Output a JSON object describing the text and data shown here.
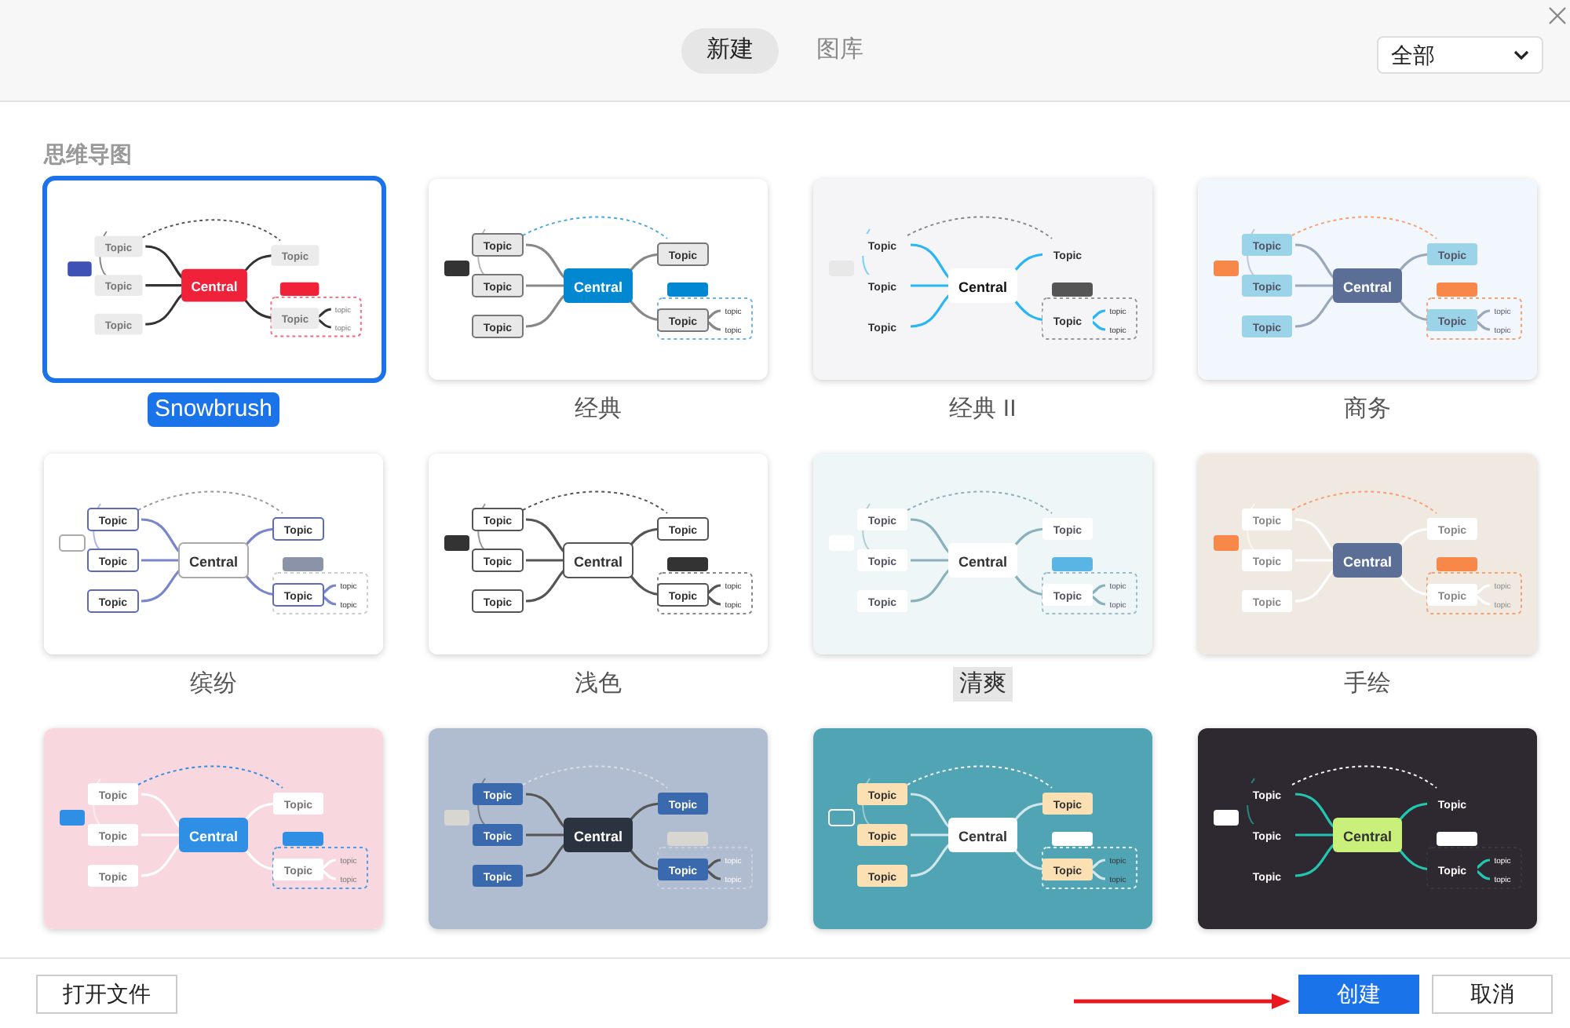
{
  "tabs": [
    {
      "label": "新建",
      "selected": true
    },
    {
      "label": "图库",
      "selected": false
    }
  ],
  "filter": {
    "value": "全部"
  },
  "section_title": "思维导图",
  "templates": [
    {
      "kind": "snowbrush",
      "label": "Snowbrush",
      "selected": true,
      "central": "Central",
      "topics": [
        "Topic",
        "Topic",
        "Topic",
        "Topic",
        "Topic"
      ],
      "subtopics": [
        "topic",
        "topic"
      ]
    },
    {
      "kind": "classic",
      "label": "经典",
      "selected": false,
      "highlighted": false,
      "central": "Central",
      "topics": [
        "Topic",
        "Topic",
        "Topic",
        "Topic",
        "Topic"
      ],
      "subtopics": [
        "topic",
        "topic"
      ]
    },
    {
      "kind": "classic2",
      "label": "经典 II",
      "selected": false,
      "highlighted": false,
      "central": "Central",
      "topics": [
        "Topic",
        "Topic",
        "Topic",
        "Topic",
        "Topic"
      ],
      "subtopics": [
        "topic",
        "topic"
      ]
    },
    {
      "kind": "business",
      "label": "商务",
      "selected": false,
      "highlighted": false,
      "central": "Central",
      "topics": [
        "Topic",
        "Topic",
        "Topic",
        "Topic",
        "Topic"
      ],
      "subtopics": [
        "topic",
        "topic"
      ]
    },
    {
      "kind": "colorful",
      "label": "缤纷",
      "selected": false,
      "highlighted": false,
      "central": "Central",
      "topics": [
        "Topic",
        "Topic",
        "Topic",
        "Topic",
        "Topic"
      ],
      "subtopics": [
        "topic",
        "topic"
      ]
    },
    {
      "kind": "light",
      "label": "浅色",
      "selected": false,
      "highlighted": false,
      "central": "Central",
      "topics": [
        "Topic",
        "Topic",
        "Topic",
        "Topic",
        "Topic"
      ],
      "subtopics": [
        "topic",
        "topic"
      ]
    },
    {
      "kind": "fresh",
      "label": "清爽",
      "selected": false,
      "highlighted": true,
      "central": "Central",
      "topics": [
        "Topic",
        "Topic",
        "Topic",
        "Topic",
        "Topic"
      ],
      "subtopics": [
        "topic",
        "topic"
      ]
    },
    {
      "kind": "handdrawn",
      "label": "手绘",
      "selected": false,
      "highlighted": false,
      "central": "Central",
      "topics": [
        "Topic",
        "Topic",
        "Topic",
        "Topic",
        "Topic"
      ],
      "subtopics": [
        "topic",
        "topic"
      ]
    },
    {
      "kind": "pink",
      "selected": false,
      "central": "Central",
      "topics": [
        "Topic",
        "Topic",
        "Topic",
        "Topic",
        "Topic"
      ],
      "subtopics": [
        "topic",
        "topic"
      ]
    },
    {
      "kind": "formal",
      "selected": false,
      "central": "Central",
      "topics": [
        "Topic",
        "Topic",
        "Topic",
        "Topic",
        "Topic"
      ],
      "subtopics": [
        "topic",
        "topic"
      ]
    },
    {
      "kind": "ocean",
      "selected": false,
      "central": "Central",
      "topics": [
        "Topic",
        "Topic",
        "Topic",
        "Topic",
        "Topic"
      ],
      "subtopics": [
        "topic",
        "topic"
      ]
    },
    {
      "kind": "dark",
      "selected": false,
      "central": "Central",
      "topics": [
        "Topic",
        "Topic",
        "Topic",
        "Topic",
        "Topic"
      ],
      "subtopics": [
        "topic",
        "topic"
      ]
    }
  ],
  "buttons": {
    "open": "打开文件",
    "create": "创建",
    "cancel": "取消"
  }
}
